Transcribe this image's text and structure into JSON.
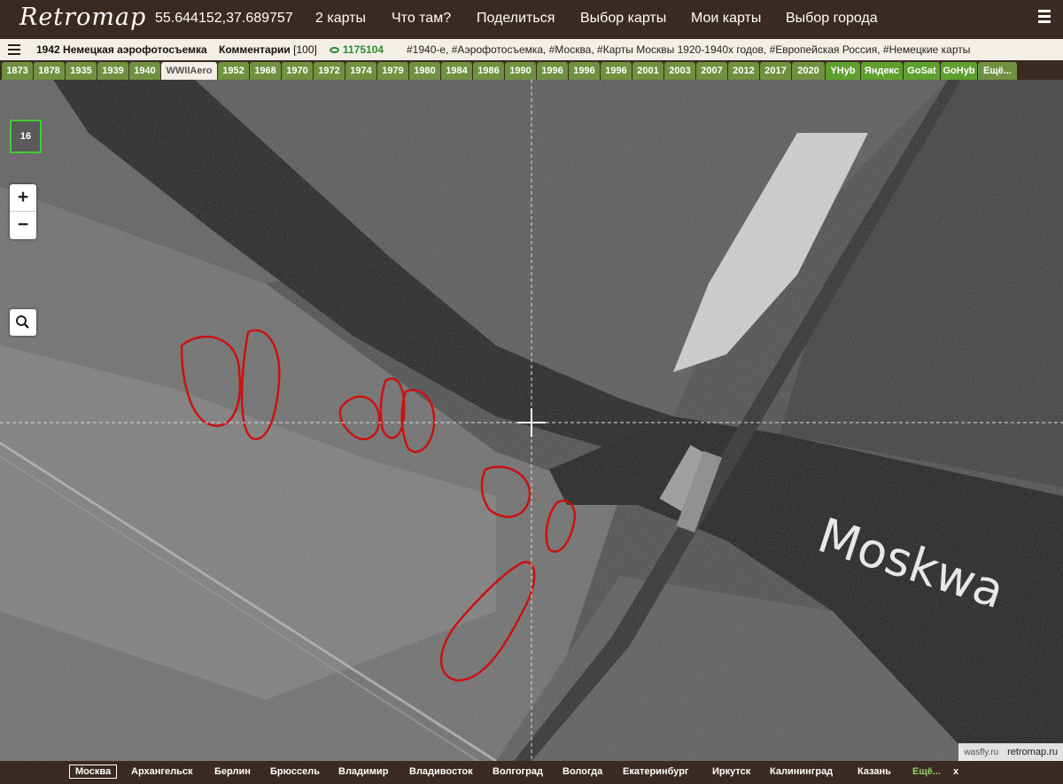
{
  "header": {
    "logo": "Retromap",
    "coords": "55.644152,37.689757",
    "nav": [
      "2 карты",
      "Что там?",
      "Поделиться",
      "Выбор карты",
      "Мои карты",
      "Выбор города"
    ]
  },
  "infobar": {
    "title": "1942 Немецкая аэрофотосъемка",
    "comments_label": "Комментарии",
    "comments_count": "[100]",
    "views": "1175104",
    "tags": "#1940-е, #Аэрофотосъемка, #Москва, #Карты Москвы 1920-1940х годов, #Европейская Россия, #Немецкие карты"
  },
  "year_tabs": [
    "1873",
    "1878",
    "1935",
    "1939",
    "1940",
    "WWIIAero",
    "1952",
    "1968",
    "1970",
    "1972",
    "1974",
    "1979",
    "1980",
    "1984",
    "1986",
    "1990",
    "1996",
    "1996",
    "1996",
    "2001",
    "2003",
    "2007",
    "2012",
    "2017",
    "2020",
    "YHyb",
    "Яндекс",
    "GoSat",
    "GoHyb",
    "Ещё..."
  ],
  "active_tab": "WWIIAero",
  "map": {
    "zoom_level": "16",
    "zoom_in": "+",
    "zoom_out": "−",
    "river_label": "Moskwa",
    "watermark_left": "wasfly.ru",
    "watermark_right": "retromap.ru"
  },
  "cities": [
    "Москва",
    "Архангельск",
    "Берлин",
    "Брюссель",
    "Владимир",
    "Владивосток",
    "Волгоград",
    "Вологда",
    "Екатеринбург",
    "Иркутск",
    "Калининград",
    "Казань",
    "Ещё...",
    "x"
  ],
  "colors": {
    "header_bg": "#3b2a23",
    "tab_green": "#6f9140",
    "annotation": "#cc1111",
    "zoom_border": "#44cc33"
  }
}
